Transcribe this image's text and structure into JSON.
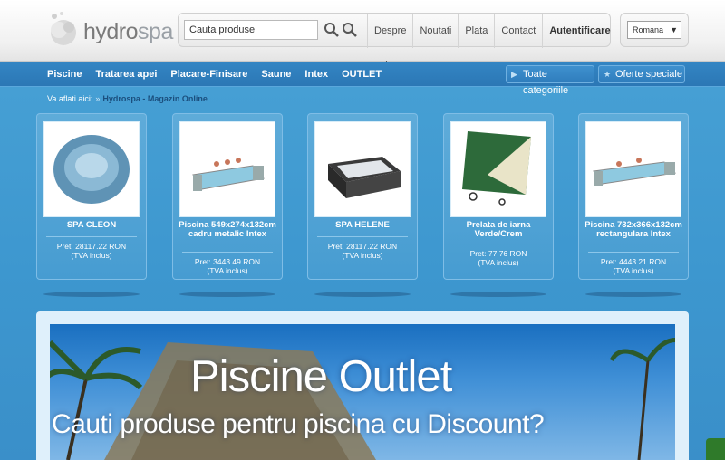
{
  "brand": {
    "logo_part1": "hydro",
    "logo_part2": "spa"
  },
  "search": {
    "placeholder": "Cauta produse",
    "value": "Cauta produse"
  },
  "toplinks": [
    "Despre noi",
    "Noutati",
    "Plata",
    "Contact",
    "Autentificare"
  ],
  "language": {
    "selected": "Romana"
  },
  "nav": {
    "items": [
      "Piscine",
      "Tratarea apei",
      "Placare-Finisare",
      "Saune",
      "Intex",
      "OUTLET"
    ],
    "all_categories": "Toate categoriile",
    "special_offers": "Oferte speciale"
  },
  "breadcrumb": {
    "prefix": "Va aflati aici:",
    "link": "Hydrospa - Magazin Online"
  },
  "products": [
    {
      "name": "SPA CLEON",
      "price": "Pret: 28117.22 RON",
      "vat": "(TVA inclus)"
    },
    {
      "name": "Piscina 549x274x132cm cadru metalic Intex",
      "price": "Pret: 3443.49 RON",
      "vat": "(TVA inclus)"
    },
    {
      "name": "SPA HELENE",
      "price": "Pret: 28117.22 RON",
      "vat": "(TVA inclus)"
    },
    {
      "name": "Prelata de iarna Verde/Crem",
      "price": "Pret: 77.76 RON",
      "vat": "(TVA inclus)"
    },
    {
      "name": "Piscina 732x366x132cm rectangulara Intex",
      "price": "Pret: 4443.21 RON",
      "vat": "(TVA inclus)"
    }
  ],
  "banner": {
    "title": "Piscine Outlet",
    "subtitle": "Cauti produse pentru piscina cu Discount?"
  },
  "icons": {
    "search": "search-icon",
    "search_advanced": "search-advanced-icon",
    "arrow": "arrow-right-icon",
    "star": "star-icon",
    "chat": "chat-icon"
  }
}
